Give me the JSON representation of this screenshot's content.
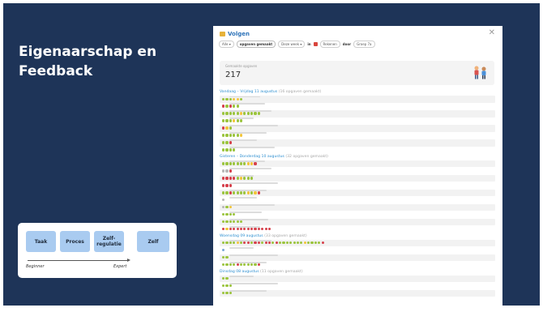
{
  "colors": {
    "slide_background": "#1e3458",
    "level_button": "#a9cbf0",
    "accent_blue": "#2e8fd0",
    "dot_green": "#9bc43d",
    "dot_yellow": "#f2c53a",
    "dot_red": "#d6404b",
    "dot_grey": "#b8b8b8",
    "dot_blue": "#7aa7d6"
  },
  "slide": {
    "title": "Eigenaarschap en Feedback"
  },
  "levels": {
    "items": [
      "Taak",
      "Proces",
      "Zelf-\nregulatie",
      "Zelf"
    ],
    "scale_start": "Beginner",
    "scale_end": "Expert"
  },
  "app": {
    "icon": "calendar-icon",
    "title": "Volgen",
    "close_icon": "close-icon",
    "filters": {
      "who": "Alle",
      "what": "opgaven gemaakt",
      "range": "Deze week",
      "in": "in",
      "subject": "Rekenen",
      "by": "door",
      "group": "Groep 7a"
    },
    "summary": {
      "label": "Gemaakte opgaven",
      "value": "217",
      "illustration": "students-illustration"
    },
    "days": [
      {
        "label": "Vandaag – Vrijdag 11 augustus",
        "note": "(16 opgaven gemaakt)",
        "rows": [
          "gggyyg",
          "rgrgg",
          "gggggyggggg",
          "gggygg",
          "ryg",
          "gggggy",
          "ggr",
          "gggg"
        ]
      },
      {
        "label": "Gisteren – Donderdag 10 augustus",
        "note": "(32 opgaven gemaakt)",
        "rows": [
          "gggggggyyr",
          "xxr",
          "rrrrgyggg",
          "rrr",
          "ggrggggygyr",
          "x",
          "xgy",
          "gggg",
          "gggggg",
          "ryrrrrrrrrrrrr"
        ]
      },
      {
        "label": "Woensdag 09 augustus",
        "note": "(33 opgaven gemaakt)",
        "rows": [
          "ggggygrrgrrgrrgrgggggggyggggr",
          "b",
          "gg",
          "ggggrgggggr"
        ]
      },
      {
        "label": "Dinsdag 08 augustus",
        "note": "(11 opgaven gemaakt)",
        "rows": [
          "gg",
          "ggg",
          "ggg"
        ]
      }
    ]
  }
}
